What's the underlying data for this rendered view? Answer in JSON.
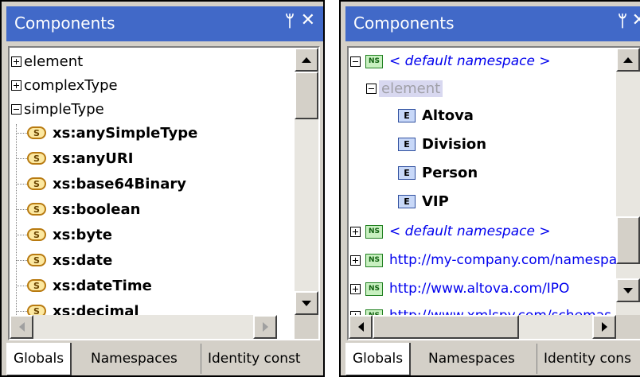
{
  "left_panel": {
    "title": "Components",
    "pin_glyph": "ᛘ",
    "close_glyph": "✕",
    "rows": [
      {
        "expander": "plus",
        "label": "element"
      },
      {
        "expander": "plus",
        "label": "complexType"
      },
      {
        "expander": "minus",
        "label": "simpleType"
      }
    ],
    "simple_types": [
      {
        "icon": "S",
        "label": "xs:anySimpleType"
      },
      {
        "icon": "S",
        "label": "xs:anyURI"
      },
      {
        "icon": "S",
        "label": "xs:base64Binary"
      },
      {
        "icon": "S",
        "label": "xs:boolean"
      },
      {
        "icon": "S",
        "label": "xs:byte"
      },
      {
        "icon": "S",
        "label": "xs:date"
      },
      {
        "icon": "S",
        "label": "xs:dateTime"
      },
      {
        "icon": "S",
        "label": "xs:decimal"
      }
    ],
    "tabs": [
      "Globals",
      "Namespaces",
      "Identity const"
    ]
  },
  "right_panel": {
    "title": "Components",
    "pin_glyph": "ᛘ",
    "close_glyph": "✕",
    "ns_icon": "NS",
    "elem_icon": "E",
    "namespace1": {
      "expander": "minus",
      "label": "< default namespace >"
    },
    "element_group": {
      "expander": "minus",
      "label": "element"
    },
    "elements": [
      "Altova",
      "Division",
      "Person",
      "VIP"
    ],
    "namespaces": [
      {
        "expander": "plus",
        "label": "< default namespace >",
        "style": "italic"
      },
      {
        "expander": "plus",
        "label": "http://my-company.com/namespace",
        "style": "url"
      },
      {
        "expander": "plus",
        "label": "http://www.altova.com/IPO",
        "style": "url"
      },
      {
        "expander": "plus",
        "label": "http://www.xmlspy.com/schemas",
        "style": "url"
      }
    ],
    "tabs": [
      "Globals",
      "Namespaces",
      "Identity cons"
    ]
  }
}
